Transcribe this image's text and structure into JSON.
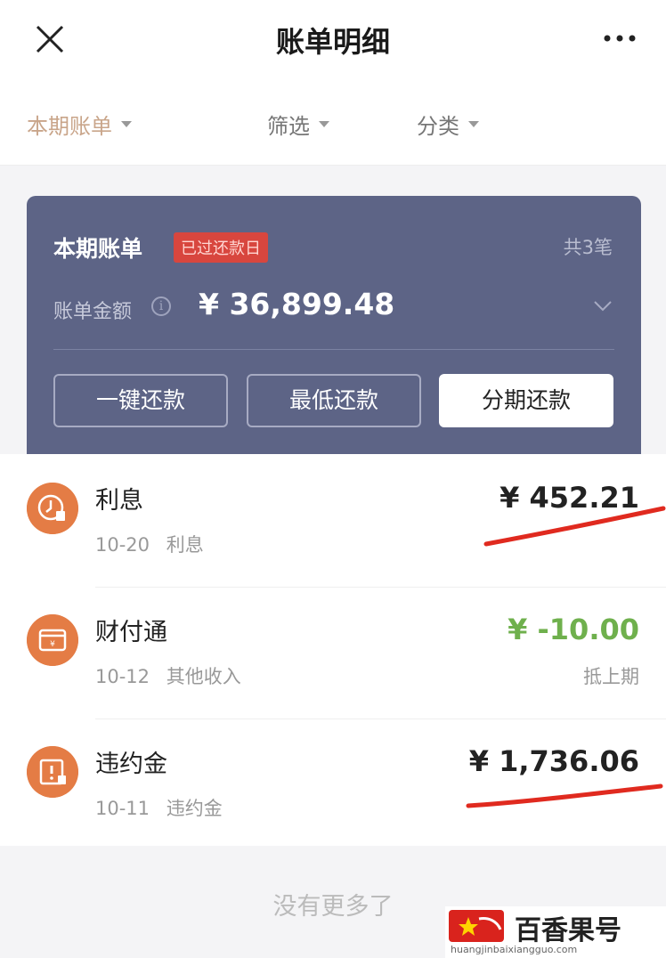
{
  "header": {
    "title": "账单明细",
    "close_icon": "close-icon",
    "more_icon": "more-dots-icon"
  },
  "filters": {
    "period": "本期账单",
    "screen": "筛选",
    "category": "分类"
  },
  "bill_card": {
    "title": "本期账单",
    "badge": "已过还款日",
    "count": "共3笔",
    "amount_label": "账单金额",
    "amount": "¥ 36,899.48",
    "buttons": {
      "repay_all": "一键还款",
      "minimum": "最低还款",
      "installment": "分期还款"
    },
    "colors": {
      "card_bg": "#5d6486",
      "badge_bg": "#d8463e"
    }
  },
  "transactions": [
    {
      "title": "利息",
      "date": "10-20",
      "type": "利息",
      "amount": "¥ 452.21",
      "note": "",
      "icon": "clock-bill-icon"
    },
    {
      "title": "财付通",
      "date": "10-12",
      "type": "其他收入",
      "amount": "¥ -10.00",
      "note": "抵上期",
      "icon": "wallet-icon"
    },
    {
      "title": "违约金",
      "date": "10-11",
      "type": "违约金",
      "amount": "¥ 1,736.06",
      "note": "",
      "icon": "penalty-icon"
    }
  ],
  "footer": {
    "text": "没有更多了"
  },
  "watermark": {
    "name": "百香果号",
    "url": "huangjinbaixiangguo.com"
  },
  "colors": {
    "income_green": "#6fb04d",
    "annotation_red": "#e02a1f",
    "icon_orange": "#e47c45"
  }
}
